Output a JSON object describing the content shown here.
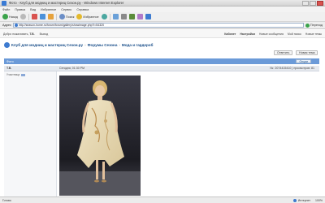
{
  "window": {
    "title": "Фото · Клуб для модниц и мастериц Сезон.ру · Windows Internet Explorer"
  },
  "menu": [
    "Файл",
    "Правка",
    "Вид",
    "Избранное",
    "Сервис",
    "Справка"
  ],
  "toolbar": {
    "back_label": "Назад",
    "search_label": "Поиск",
    "favorites_label": "Избранное"
  },
  "address": {
    "label": "Адрес",
    "url": "http://season-home.ru/forum/forum/gallery/showimage.php?i=54320",
    "go_label": "Переход"
  },
  "userbar": {
    "greeting": "Добро пожаловать,",
    "username": "Т.В.",
    "exit_label": "Выход",
    "right_links": [
      "Кабинет",
      "Настройки",
      "Новые сообщения",
      "Мой поиск",
      "Новые темы"
    ]
  },
  "breadcrumb": [
    "Клуб для модниц и мастериц Сезон.ру",
    "Форумы Сезона",
    "Мода и гардероб"
  ],
  "buttons": {
    "upload": "Ответить",
    "edit": "Новая тема"
  },
  "section": {
    "title": "Фото",
    "tools_label": "Опции"
  },
  "post": {
    "author": "Т.В.",
    "date": "Сегодня, 01:30 PM",
    "meta": "№: 2074415410 | просмотров: 81",
    "user_label": "Участница",
    "figure": "model on runway in pale champagne printed dress"
  },
  "status": {
    "text": "Готово",
    "zone": "Интернет",
    "zoom": "100%"
  },
  "colors": {
    "accent": "#6b9ad8",
    "link": "#1a4f8a"
  }
}
